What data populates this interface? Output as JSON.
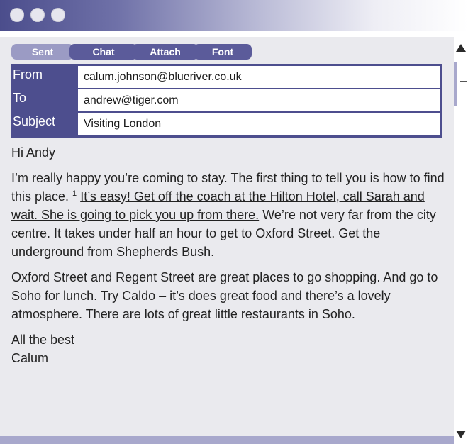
{
  "tabs": [
    {
      "label": "Sent"
    },
    {
      "label": "Chat"
    },
    {
      "label": "Attach"
    },
    {
      "label": "Font"
    }
  ],
  "header": {
    "from_label": "From",
    "from_value": "calum.johnson@blueriver.co.uk",
    "to_label": "To",
    "to_value": "andrew@tiger.com",
    "subject_label": "Subject",
    "subject_value": "Visiting London"
  },
  "message": {
    "greeting": "Hi Andy",
    "p1_start": "I’m really happy you’re coming to stay. The first thing to tell you is how to find this place. ",
    "footnote": "1",
    "p1_underlined": "It’s easy! Get off the coach at the Hilton Hotel, call Sarah and wait. She is going to pick you up from there.",
    "p1_end": " We’re not very far from the city centre. It takes under half an hour to get to Oxford Street. Get the underground from Shepherds Bush.",
    "p2": "Oxford Street and Regent Street are great places to go shopping. And go to Soho for lunch. Try Caldo – it’s does great food and there’s a lovely atmosphere. There are lots of great little restaurants in Soho.",
    "signoff": "All the best",
    "signature": "Calum"
  },
  "colors": {
    "accent": "#4d4e8e",
    "tab": "#5b5b9a",
    "tab_active": "#9b9bc4",
    "background": "#eaeaee"
  },
  "icons": {
    "scroll_up": "triangle-up-icon",
    "scroll_down": "triangle-down-icon"
  }
}
